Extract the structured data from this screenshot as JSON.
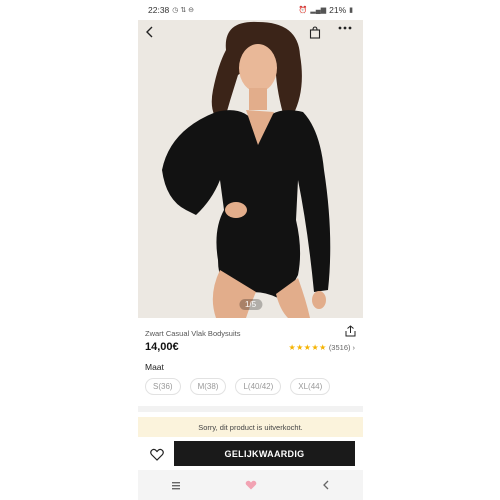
{
  "status_bar": {
    "time": "22:38",
    "battery": "21%"
  },
  "image": {
    "counter": "1/5"
  },
  "product": {
    "title": "Zwart Casual Vlak Bodysuits",
    "price": "14,00€",
    "stars": "★★★★★",
    "review_count": "(3516)",
    "size_label": "Maat",
    "sizes": [
      "S(36)",
      "M(38)",
      "L(40/42)",
      "XL(44)"
    ]
  },
  "notice": {
    "sold_out": "Sorry, dit product is uitverkocht."
  },
  "actions": {
    "similar_button": "GELIJKWAARDIG"
  },
  "colors": {
    "star": "#f5b301",
    "button_bg": "#1a1a1a",
    "notice_bg": "#fbf3dc"
  }
}
